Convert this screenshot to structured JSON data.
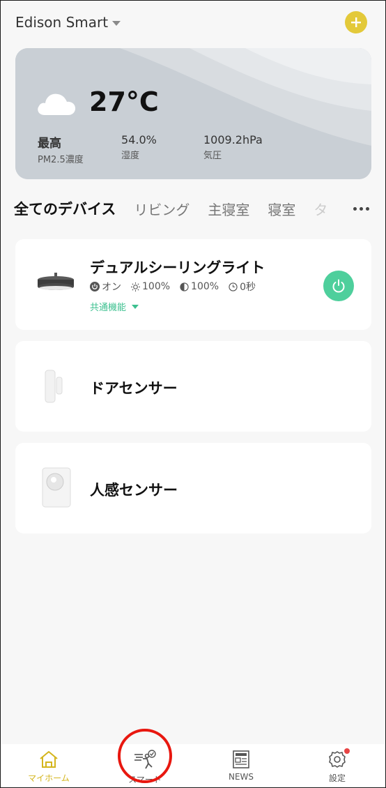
{
  "header": {
    "home_name": "Edison Smart",
    "add_icon": "plus-icon",
    "accent": "#e3c93a"
  },
  "weather": {
    "temperature": "27°C",
    "stats": [
      {
        "value": "最高",
        "label": "PM2.5濃度"
      },
      {
        "value": "54.0%",
        "label": "湿度"
      },
      {
        "value": "1009.2hPa",
        "label": "気圧"
      }
    ],
    "icon": "cloud-icon"
  },
  "tabs": [
    {
      "label": "全てのデバイス"
    },
    {
      "label": "リビング"
    },
    {
      "label": "主寝室"
    },
    {
      "label": "寝室"
    },
    {
      "label": "タ"
    }
  ],
  "devices": [
    {
      "name": "デュアルシーリングライト",
      "status": {
        "power": "オン",
        "brightness": "100%",
        "color_temp": "100%",
        "timer": "0秒"
      },
      "common_label": "共通機能",
      "power_color": "#4ecf9c"
    },
    {
      "name": "ドアセンサー"
    },
    {
      "name": "人感センサー"
    }
  ],
  "nav": [
    {
      "label": "マイホーム",
      "icon": "home-icon"
    },
    {
      "label": "スマート",
      "icon": "smart-scene-icon"
    },
    {
      "label": "NEWS",
      "icon": "newspaper-icon"
    },
    {
      "label": "設定",
      "icon": "gear-icon"
    }
  ]
}
